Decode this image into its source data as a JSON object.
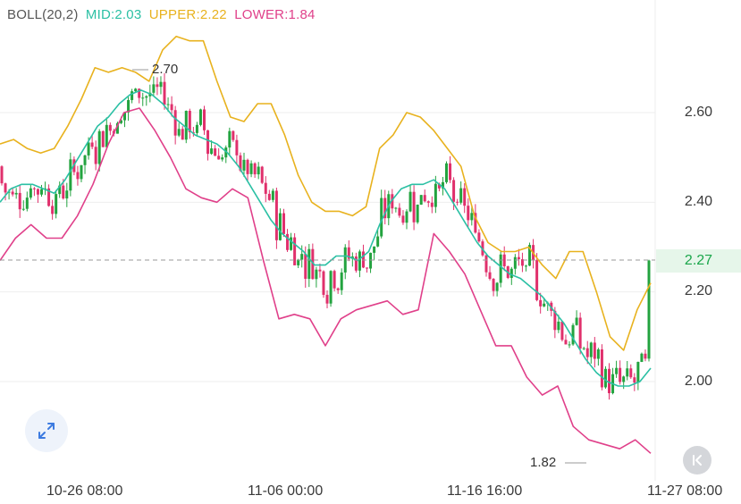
{
  "legend": {
    "indicator": "BOLL(20,2)",
    "mid": "MID:2.03",
    "upper": "UPPER:2.22",
    "lower": "LOWER:1.84"
  },
  "colors": {
    "mid": "#2bc0a4",
    "upper": "#e8b21e",
    "lower": "#e0408a",
    "up_candle": "#23a33f",
    "down_candle": "#e0306c",
    "last_tag_text": "#1aa64a",
    "label_gray": "#555555"
  },
  "y_axis": {
    "ticks": [
      "2.60",
      "2.40",
      "2.20",
      "2.00"
    ]
  },
  "x_axis": {
    "ticks": [
      "10-26 08:00",
      "11-06 00:00",
      "11-16 16:00",
      "11-27 08:00"
    ]
  },
  "last_price": "2.27",
  "annotations": {
    "high": "2.70",
    "low": "1.82"
  },
  "buttons": {
    "expand_icon": "expand-arrows-icon",
    "back_icon": "chevron-left-bar-icon"
  },
  "chart_data": {
    "type": "candlestick",
    "indicator": "BOLL(20,2)",
    "ylim": [
      1.8,
      2.81
    ],
    "x_ticks": [
      "10-26 08:00",
      "11-06 00:00",
      "11-16 16:00",
      "11-27 08:00"
    ],
    "y_ticks": [
      2.0,
      2.2,
      2.4,
      2.6
    ],
    "high": 2.7,
    "low": 1.82,
    "last": 2.27,
    "grid": true,
    "series": [
      {
        "name": "MID",
        "values": [
          2.4,
          2.43,
          2.44,
          2.44,
          2.43,
          2.42,
          2.45,
          2.49,
          2.53,
          2.57,
          2.59,
          2.62,
          2.64,
          2.65,
          2.64,
          2.62,
          2.59,
          2.57,
          2.55,
          2.54,
          2.53,
          2.51,
          2.48,
          2.44,
          2.4,
          2.36,
          2.33,
          2.31,
          2.29,
          2.26,
          2.26,
          2.28,
          2.28,
          2.27,
          2.29,
          2.35,
          2.4,
          2.43,
          2.44,
          2.44,
          2.45,
          2.43,
          2.39,
          2.35,
          2.31,
          2.28,
          2.26,
          2.24,
          2.23,
          2.21,
          2.19,
          2.16,
          2.13,
          2.09,
          2.05,
          2.02,
          2.0,
          1.99,
          1.99,
          2.0,
          2.03
        ]
      },
      {
        "name": "UPPER",
        "values": [
          2.53,
          2.54,
          2.52,
          2.51,
          2.52,
          2.57,
          2.63,
          2.7,
          2.69,
          2.7,
          2.69,
          2.67,
          2.74,
          2.77,
          2.76,
          2.76,
          2.67,
          2.59,
          2.58,
          2.62,
          2.62,
          2.55,
          2.46,
          2.4,
          2.38,
          2.38,
          2.37,
          2.39,
          2.52,
          2.55,
          2.6,
          2.59,
          2.56,
          2.52,
          2.48,
          2.37,
          2.31,
          2.29,
          2.29,
          2.3,
          2.26,
          2.23,
          2.29,
          2.29,
          2.2,
          2.1,
          2.07,
          2.16,
          2.22
        ]
      },
      {
        "name": "LOWER",
        "values": [
          2.27,
          2.32,
          2.35,
          2.32,
          2.32,
          2.37,
          2.44,
          2.53,
          2.6,
          2.61,
          2.56,
          2.5,
          2.43,
          2.41,
          2.4,
          2.43,
          2.41,
          2.27,
          2.14,
          2.15,
          2.14,
          2.08,
          2.14,
          2.16,
          2.17,
          2.18,
          2.15,
          2.16,
          2.33,
          2.29,
          2.24,
          2.16,
          2.08,
          2.08,
          2.01,
          1.97,
          1.99,
          1.9,
          1.87,
          1.86,
          1.85,
          1.87,
          1.84
        ]
      }
    ]
  }
}
